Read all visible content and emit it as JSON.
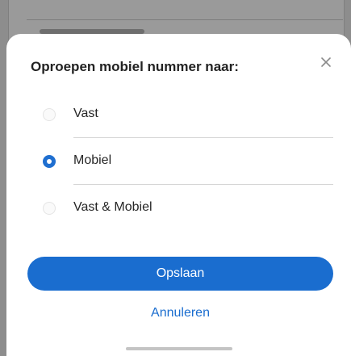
{
  "dialog": {
    "title": "Oproepen mobiel nummer naar:",
    "close_icon": "close-icon"
  },
  "options": [
    {
      "label": "Vast",
      "selected": false
    },
    {
      "label": "Mobiel",
      "selected": true
    },
    {
      "label": "Vast & Mobiel",
      "selected": false
    }
  ],
  "actions": {
    "save_label": "Opslaan",
    "cancel_label": "Annuleren"
  },
  "colors": {
    "accent": "#1a6dcf",
    "overlay": "#8d8d8d",
    "sheet_background": "#ffffff"
  }
}
